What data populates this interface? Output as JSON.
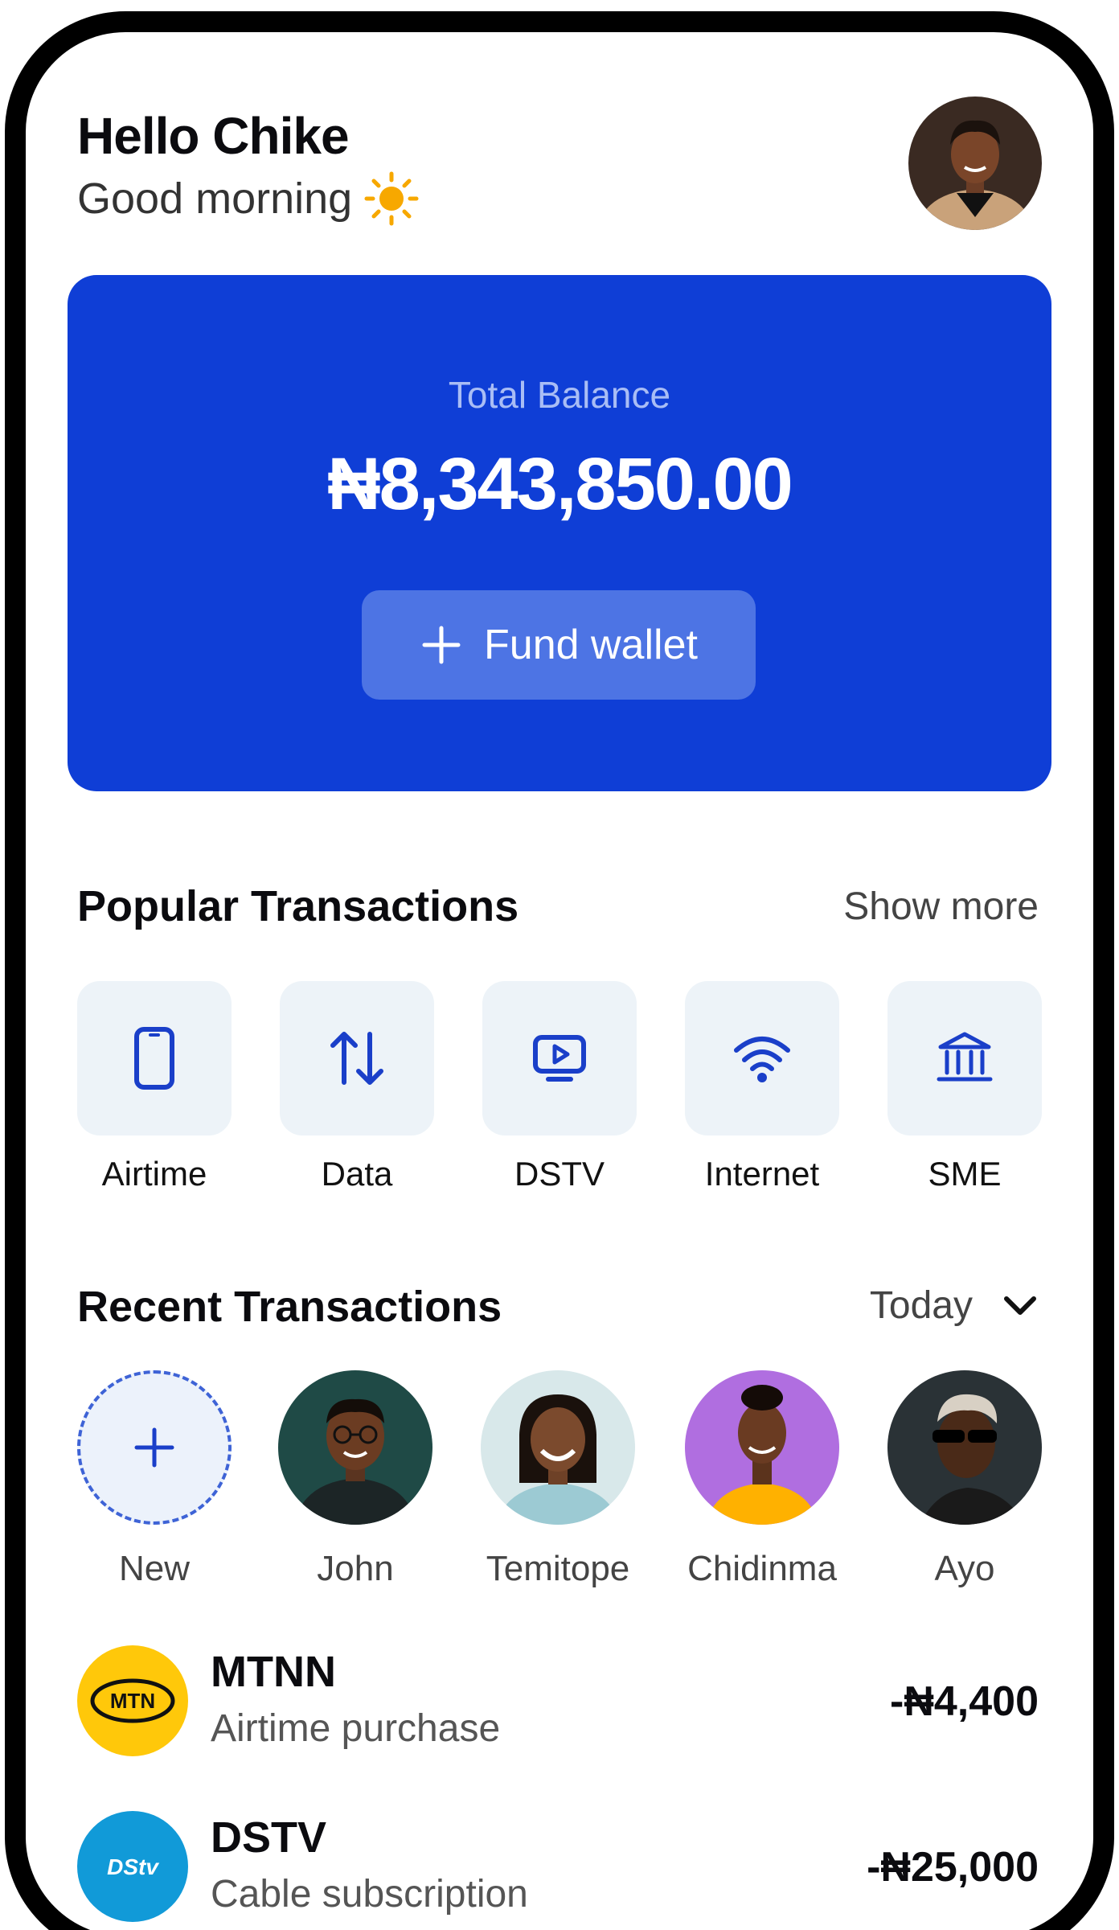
{
  "header": {
    "greeting": "Hello Chike",
    "subgreeting": "Good morning"
  },
  "balance": {
    "label": "Total Balance",
    "amount": "₦8,343,850.00",
    "fund_label": "Fund wallet"
  },
  "popular": {
    "title": "Popular Transactions",
    "link": "Show more",
    "items": [
      {
        "label": "Airtime",
        "icon": "phone-icon"
      },
      {
        "label": "Data",
        "icon": "data-arrows-icon"
      },
      {
        "label": "DSTV",
        "icon": "tv-play-icon"
      },
      {
        "label": "Internet",
        "icon": "wifi-icon"
      },
      {
        "label": "SME",
        "icon": "bank-icon"
      }
    ]
  },
  "recent": {
    "title": "Recent Transactions",
    "filter": "Today",
    "contacts": [
      {
        "label": "New"
      },
      {
        "label": "John"
      },
      {
        "label": "Temitope"
      },
      {
        "label": "Chidinma"
      },
      {
        "label": "Ayo"
      }
    ],
    "transactions": [
      {
        "name": "MTNN",
        "desc": "Airtime purchase",
        "amount": "-₦4,400",
        "logo_text": "MTN",
        "color": "#ffc80a"
      },
      {
        "name": "DSTV",
        "desc": "Cable subscription",
        "amount": "-₦25,000",
        "logo_text": "DStv",
        "color": "#119ad8"
      }
    ]
  },
  "colors": {
    "primary": "#0f3ed6",
    "tile_bg": "#edf3f8",
    "sun": "#f7a800"
  }
}
